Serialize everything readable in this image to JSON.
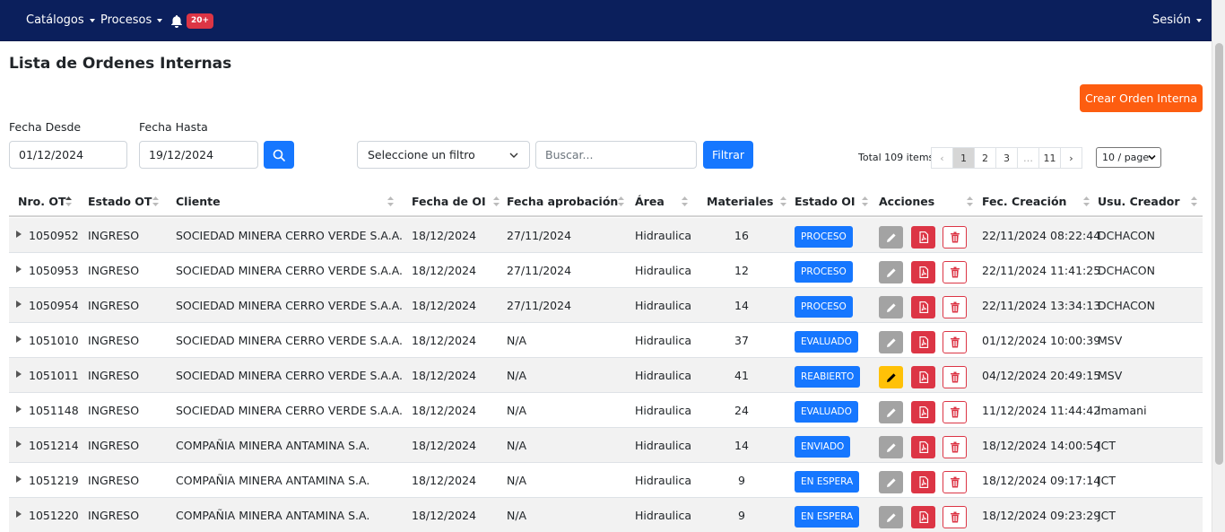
{
  "navbar": {
    "menu": [
      {
        "label": "Catálogos"
      },
      {
        "label": "Procesos"
      }
    ],
    "notifications_badge": "20+",
    "session_label": "Sesión"
  },
  "page": {
    "title": "Lista de Ordenes Internas",
    "create_button": "Crear Orden Interna"
  },
  "filters": {
    "date_from_label": "Fecha Desde",
    "date_from_value": "01/12/2024",
    "date_to_label": "Fecha Hasta",
    "date_to_value": "19/12/2024",
    "select_placeholder": "Seleccione un filtro",
    "search_placeholder": "Buscar...",
    "filter_button": "Filtrar"
  },
  "pagination": {
    "total": "Total 109 items",
    "pages": [
      "‹",
      "1",
      "2",
      "3",
      "…",
      "11",
      "›"
    ],
    "current_page": "1",
    "page_size": "10 / page"
  },
  "table": {
    "columns": [
      "Nro. OT",
      "Estado OT",
      "Cliente",
      "Fecha de OI",
      "Fecha aprobación",
      "Área",
      "Materiales",
      "Estado OI",
      "Acciones",
      "Fec. Creación",
      "Usu. Creador"
    ],
    "rows": [
      {
        "nro": "1050952",
        "estado_ot": "INGRESO",
        "cliente": "SOCIEDAD MINERA CERRO VERDE S.A.A.",
        "fecha_oi": "18/12/2024",
        "fecha_aprob": "27/11/2024",
        "area": "Hidraulica",
        "materiales": "16",
        "estado_oi": "PROCESO",
        "fec_creacion": "22/11/2024 08:22:44",
        "usuario": "DCHACON",
        "edit_highlight": false
      },
      {
        "nro": "1050953",
        "estado_ot": "INGRESO",
        "cliente": "SOCIEDAD MINERA CERRO VERDE S.A.A.",
        "fecha_oi": "18/12/2024",
        "fecha_aprob": "27/11/2024",
        "area": "Hidraulica",
        "materiales": "12",
        "estado_oi": "PROCESO",
        "fec_creacion": "22/11/2024 11:41:25",
        "usuario": "DCHACON",
        "edit_highlight": false
      },
      {
        "nro": "1050954",
        "estado_ot": "INGRESO",
        "cliente": "SOCIEDAD MINERA CERRO VERDE S.A.A.",
        "fecha_oi": "18/12/2024",
        "fecha_aprob": "27/11/2024",
        "area": "Hidraulica",
        "materiales": "14",
        "estado_oi": "PROCESO",
        "fec_creacion": "22/11/2024 13:34:13",
        "usuario": "DCHACON",
        "edit_highlight": false
      },
      {
        "nro": "1051010",
        "estado_ot": "INGRESO",
        "cliente": "SOCIEDAD MINERA CERRO VERDE S.A.A.",
        "fecha_oi": "18/12/2024",
        "fecha_aprob": "N/A",
        "area": "Hidraulica",
        "materiales": "37",
        "estado_oi": "EVALUADO",
        "fec_creacion": "01/12/2024 10:00:39",
        "usuario": "MSV",
        "edit_highlight": false
      },
      {
        "nro": "1051011",
        "estado_ot": "INGRESO",
        "cliente": "SOCIEDAD MINERA CERRO VERDE S.A.A.",
        "fecha_oi": "18/12/2024",
        "fecha_aprob": "N/A",
        "area": "Hidraulica",
        "materiales": "41",
        "estado_oi": "REABIERTO",
        "fec_creacion": "04/12/2024 20:49:15",
        "usuario": "MSV",
        "edit_highlight": true
      },
      {
        "nro": "1051148",
        "estado_ot": "INGRESO",
        "cliente": "SOCIEDAD MINERA CERRO VERDE S.A.A.",
        "fecha_oi": "18/12/2024",
        "fecha_aprob": "N/A",
        "area": "Hidraulica",
        "materiales": "24",
        "estado_oi": "EVALUADO",
        "fec_creacion": "11/12/2024 11:44:42",
        "usuario": "lmamani",
        "edit_highlight": false
      },
      {
        "nro": "1051214",
        "estado_ot": "INGRESO",
        "cliente": "COMPAÑIA MINERA ANTAMINA S.A.",
        "fecha_oi": "18/12/2024",
        "fecha_aprob": "N/A",
        "area": "Hidraulica",
        "materiales": "14",
        "estado_oi": "ENVIADO",
        "fec_creacion": "18/12/2024 14:00:54",
        "usuario": "JCT",
        "edit_highlight": false
      },
      {
        "nro": "1051219",
        "estado_ot": "INGRESO",
        "cliente": "COMPAÑIA MINERA ANTAMINA S.A.",
        "fecha_oi": "18/12/2024",
        "fecha_aprob": "N/A",
        "area": "Hidraulica",
        "materiales": "9",
        "estado_oi": "EN ESPERA",
        "fec_creacion": "18/12/2024 09:17:14",
        "usuario": "JCT",
        "edit_highlight": false
      },
      {
        "nro": "1051220",
        "estado_ot": "INGRESO",
        "cliente": "COMPAÑIA MINERA ANTAMINA S.A.",
        "fecha_oi": "18/12/2024",
        "fecha_aprob": "N/A",
        "area": "Hidraulica",
        "materiales": "9",
        "estado_oi": "EN ESPERA",
        "fec_creacion": "18/12/2024 09:23:29",
        "usuario": "JCT",
        "edit_highlight": false
      }
    ]
  },
  "colors": {
    "navbar": "#0b1f5c",
    "primary": "#1677ff",
    "create": "#fd5d10",
    "danger": "#dc3545",
    "warning": "#ffc107",
    "edit_grey": "#a3a3a3"
  }
}
